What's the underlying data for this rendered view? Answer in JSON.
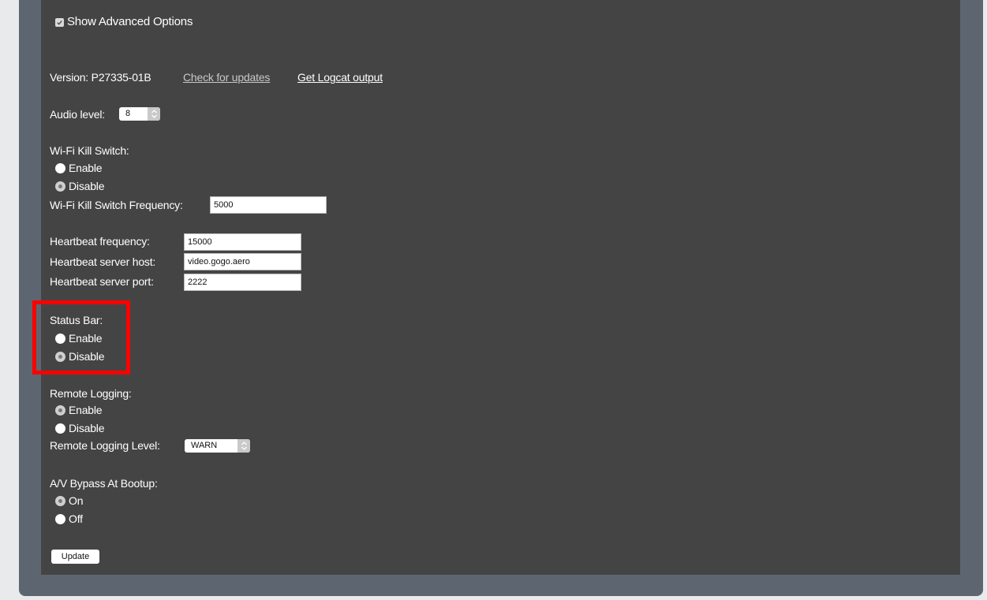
{
  "advanced": {
    "show_label": "Show Advanced Options",
    "checked": true
  },
  "version": {
    "label": "Version: P27335-01B",
    "check_updates_link": "Check for updates",
    "logcat_link": "Get Logcat output"
  },
  "audio": {
    "label": "Audio level:",
    "value": "8"
  },
  "wifi_kill": {
    "label": "Wi-Fi Kill Switch:",
    "enable": "Enable",
    "disable": "Disable",
    "selected": "Disable",
    "frequency_label": "Wi-Fi Kill Switch Frequency:",
    "frequency_value": "5000"
  },
  "heartbeat": {
    "frequency_label": "Heartbeat frequency:",
    "frequency_value": "15000",
    "host_label": "Heartbeat server host:",
    "host_value": "video.gogo.aero",
    "port_label": "Heartbeat server port:",
    "port_value": "2222"
  },
  "status_bar": {
    "label": "Status Bar:",
    "enable": "Enable",
    "disable": "Disable",
    "selected": "Disable",
    "highlight_color": "#ff0000"
  },
  "remote_logging": {
    "label": "Remote Logging:",
    "enable": "Enable",
    "disable": "Disable",
    "selected": "Enable",
    "level_label": "Remote Logging Level:",
    "level_value": "WARN"
  },
  "av_bypass": {
    "label": "A/V Bypass At Bootup:",
    "on": "On",
    "off": "Off",
    "selected": "On"
  },
  "update_button": "Update",
  "colors": {
    "panel_bg": "#444444",
    "frame_bg": "#5d6670",
    "page_bg": "#e9eaec",
    "text": "#ffffff",
    "link_dim": "#c8c8c8"
  }
}
